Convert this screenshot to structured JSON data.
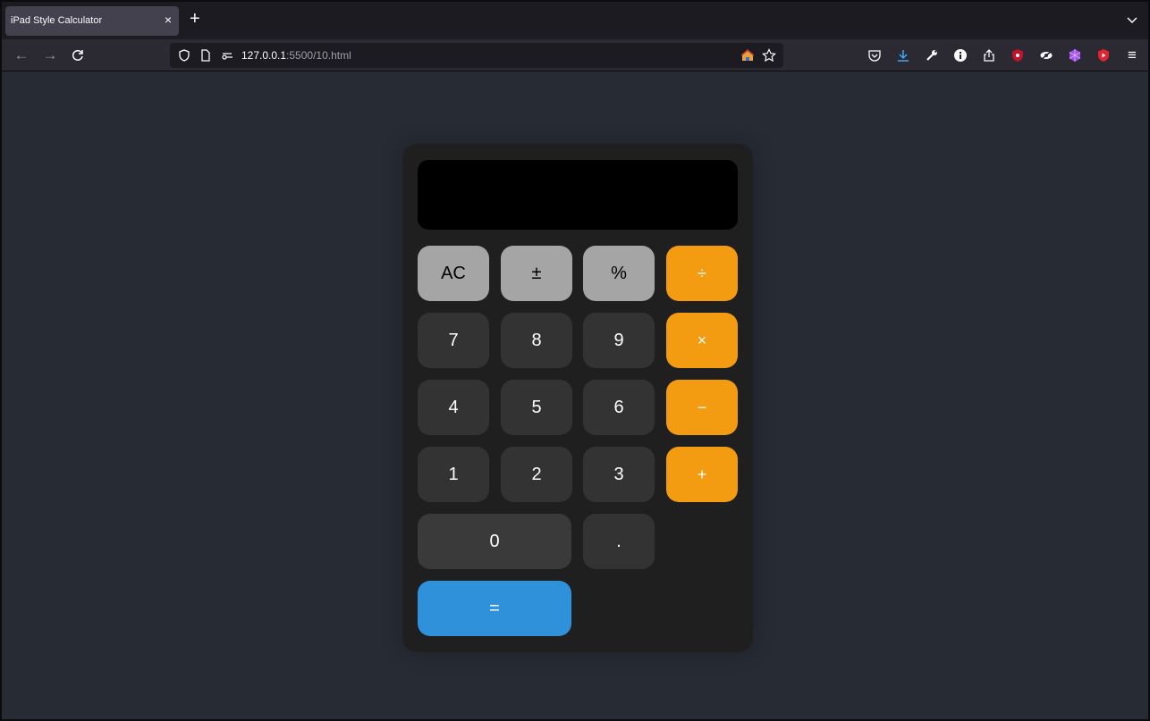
{
  "browser": {
    "tab_title": "iPad Style Calculator",
    "tab_close": "×",
    "new_tab": "+",
    "back": "←",
    "forward": "→",
    "reload": "C",
    "url_host": "127.0.0.1",
    "url_path": ":5500/10.html",
    "menu": "≡"
  },
  "calculator": {
    "display_value": "",
    "keys": {
      "ac": "AC",
      "plus_minus": "±",
      "percent": "%",
      "divide": "÷",
      "seven": "7",
      "eight": "8",
      "nine": "9",
      "multiply": "×",
      "four": "4",
      "five": "5",
      "six": "6",
      "minus": "−",
      "one": "1",
      "two": "2",
      "three": "3",
      "plus": "+",
      "zero": "0",
      "decimal": ".",
      "equals": "="
    }
  },
  "colors": {
    "page_bg": "#272b34",
    "calc_bg": "#1f1f1f",
    "function_key": "#a5a5a5",
    "number_key": "#333333",
    "operator_key": "#f39c12",
    "equals_key": "#2e91d9"
  }
}
